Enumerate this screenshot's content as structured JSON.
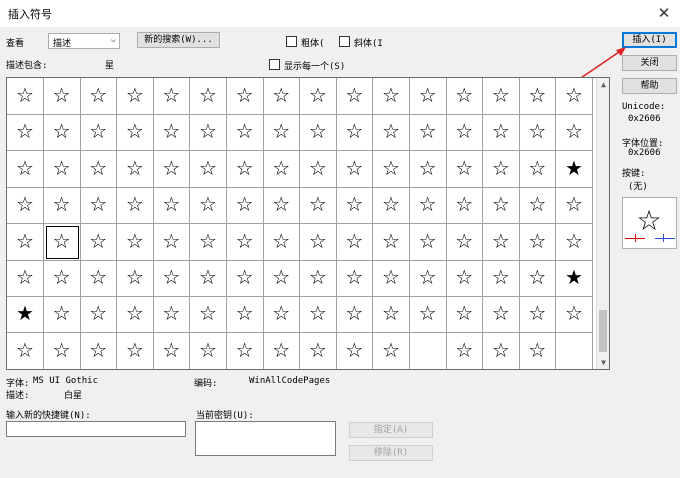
{
  "window": {
    "title": "插入符号",
    "close": "✕"
  },
  "toolbar": {
    "view_label": "查看",
    "view_select_value": "描述",
    "new_search_label": "新的搜索(W)...",
    "bold_label": "粗体(",
    "italic_label": "斜体(I"
  },
  "filter": {
    "desc_contains_label": "描述包含:",
    "desc_contains_value": "星",
    "show_each_label": "显示每一个(S)"
  },
  "buttons": {
    "insert": "插入(I)",
    "close": "关闭",
    "help": "帮助",
    "assign": "指定(A)",
    "remove": "移除(R)"
  },
  "side_info": {
    "unicode_label": "Unicode:",
    "unicode_value": "0x2606",
    "char_pos_label": "字体位置:",
    "char_pos_value": "0x2606",
    "keystroke_label": "按键:",
    "keystroke_value": "(无)"
  },
  "preview": {
    "char": "☆"
  },
  "grid": {
    "selected": [
      4,
      1
    ],
    "rows": [
      [
        "☆",
        "☆",
        "☆",
        "☆",
        "☆",
        "☆",
        "☆",
        "☆",
        "☆",
        "☆",
        "☆",
        "☆",
        "☆",
        "☆",
        "☆",
        "☆"
      ],
      [
        "☆",
        "☆",
        "☆",
        "☆",
        "☆",
        "☆",
        "☆",
        "☆",
        "☆",
        "☆",
        "☆",
        "☆",
        "☆",
        "☆",
        "☆",
        "☆"
      ],
      [
        "☆",
        "☆",
        "☆",
        "☆",
        "☆",
        "☆",
        "☆",
        "☆",
        "☆",
        "☆",
        "☆",
        "☆",
        "☆",
        "☆",
        "☆",
        "★"
      ],
      [
        "☆",
        "☆",
        "☆",
        "☆",
        "☆",
        "☆",
        "☆",
        "☆",
        "☆",
        "☆",
        "☆",
        "☆",
        "☆",
        "☆",
        "☆",
        "☆"
      ],
      [
        "☆",
        "☆",
        "☆",
        "☆",
        "☆",
        "☆",
        "☆",
        "☆",
        "☆",
        "☆",
        "☆",
        "☆",
        "☆",
        "☆",
        "☆",
        "☆"
      ],
      [
        "☆",
        "☆",
        "☆",
        "☆",
        "☆",
        "☆",
        "☆",
        "☆",
        "☆",
        "☆",
        "☆",
        "☆",
        "☆",
        "☆",
        "☆",
        "★"
      ],
      [
        "★",
        "☆",
        "☆",
        "☆",
        "☆",
        "☆",
        "☆",
        "☆",
        "☆",
        "☆",
        "☆",
        "☆",
        "☆",
        "☆",
        "☆",
        "☆"
      ],
      [
        "☆",
        "☆",
        "☆",
        "☆",
        "☆",
        "☆",
        "☆",
        "☆",
        "☆",
        "☆",
        "☆",
        "",
        "☆",
        "☆",
        "☆",
        ""
      ]
    ]
  },
  "footer": {
    "font_label": "字体:",
    "font_value": "MS UI Gothic",
    "encoding_label": "编码:",
    "encoding_value": "WinAllCodePages",
    "desc_label": "描述:",
    "desc_value": "白星",
    "new_shortcut_label": "输入新的快捷键(N):",
    "current_keys_label": "当前密钥(U):"
  },
  "colors": {
    "annotation_arrow": "#e02020",
    "focus_blue": "#0078d7"
  }
}
